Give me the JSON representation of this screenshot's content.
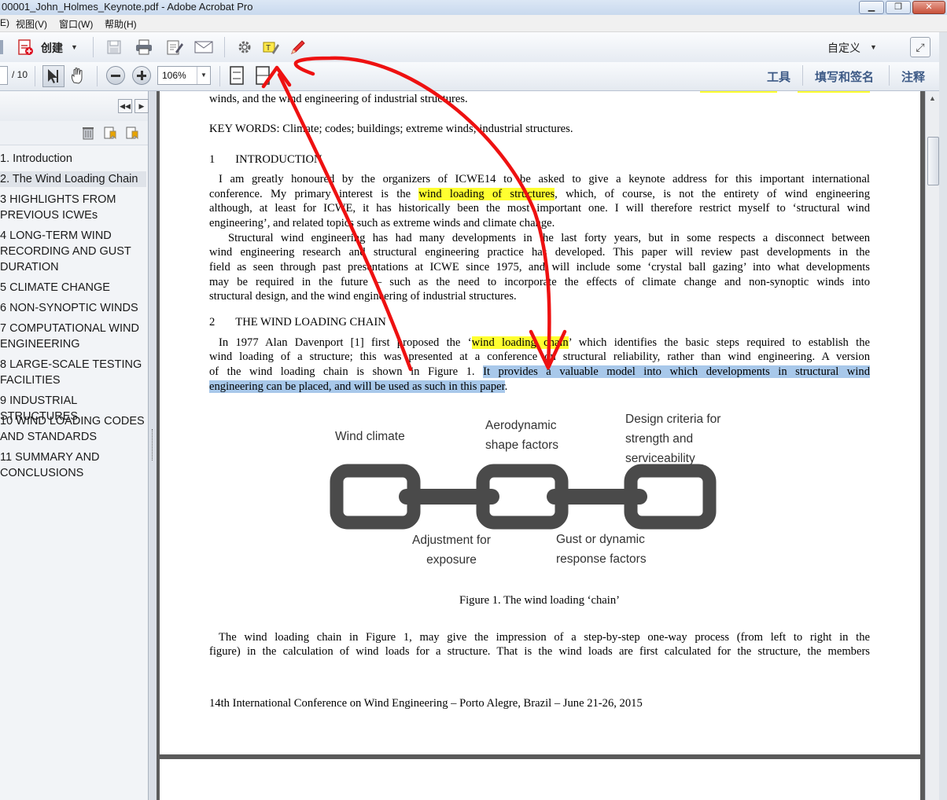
{
  "window": {
    "title": "00001_John_Holmes_Keynote.pdf - Adobe Acrobat Pro"
  },
  "menu": [
    "E)",
    "视图(V)",
    "窗口(W)",
    "帮助(H)"
  ],
  "toolbar": {
    "create_label": "创建",
    "customize_label": "自定义",
    "page_suffix": "/ 10",
    "zoom_value": "106%",
    "tools_label": "工具",
    "fill_sign_label": "填写和签名",
    "comment_label": "注释"
  },
  "bookmarks": [
    "1. Introduction",
    "2. The Wind Loading Chain",
    "3 HIGHLIGHTS FROM\nPREVIOUS ICWEs",
    "4 LONG-TERM WIND\nRECORDING AND GUST\nDURATION",
    "5 CLIMATE CHANGE",
    "6 NON-SYNOPTIC WINDS",
    "7 COMPUTATIONAL WIND\nENGINEERING",
    "8 LARGE-SCALE TESTING\nFACILITIES",
    "9 INDUSTRIAL STRUCTURES",
    "10 WIND LOADING CODES\nAND STANDARDS",
    "11 SUMMARY AND\nCONCLUSIONS"
  ],
  "document": {
    "line_top": "winds, and the wind engineering of industrial structures.",
    "keywords": "KEY WORDS: Climate; codes; buildings; extreme winds; industrial structures.",
    "h1_num": "1",
    "h1_title": "INTRODUCTION",
    "p1_l1": "I am greatly honoured by the organizers of ICWE14 to be asked to give a keynote address for this important international",
    "p1_l2a": "conference.    My primary interest is the ",
    "p1_l2_hl": "wind loading of structures",
    "p1_l2b": ", which, of course, is not the entirety of wind engineering",
    "p1_l3": "although, at least for ICWE, it has historically been the most important one.    I will therefore restrict myself to ‘structural wind",
    "p1_l4": "engineering’, and related topics such as extreme winds and climate change.",
    "p2_l1": "Structural wind engineering has had many developments in the last forty years, but in some respects a disconnect between",
    "p2_l2": "wind engineering research and structural engineering practice has developed.   This paper will review past developments in the",
    "p2_l3": "field as seen through past presentations at ICWE since 1975, and will include some ‘crystal ball gazing’ into what developments",
    "p2_l4": "may be required in the future – such as the need to incorporate the effects of climate change and non-synoptic winds into",
    "p2_l5": "structural design, and the wind engineering of industrial structures.",
    "h2_num": "2",
    "h2_title": "THE WIND LOADING CHAIN",
    "p3_l1a": "In 1977 Alan Davenport [1] first proposed the ‘",
    "p3_l1_hl": "wind loading chain",
    "p3_l1b": "’ which identifies the basic steps required to establish the",
    "p3_l2": "wind loading of a structure; this was presented at a conference on structural reliability, rather than wind engineering.   A version",
    "p3_l3a": "of the wind loading chain is shown in Figure 1.    ",
    "p3_l3_sel": "It provides a valuable model into which developments in structural wind",
    "p3_l4_sel": "engineering can be placed, and will be used as such in this paper",
    "p3_l4b": ".",
    "fig_wind_climate": "Wind climate",
    "fig_aero": "Aerodynamic\nshape factors",
    "fig_design": "Design criteria for\nstrength and\nserviceability",
    "fig_adjust": "Adjustment for\nexposure",
    "fig_gust": "Gust or dynamic\nresponse factors",
    "fig_caption": "Figure 1. The wind loading ‘chain’",
    "p4_l1": "The wind loading chain in Figure 1, may give the impression of a step-by-step one-way process (from left to right in the",
    "p4_l2": "figure) in the calculation of wind loads for a structure.   That is the wind loads are first calculated for the structure, the members",
    "footer": "14th International Conference on Wind Engineering – Porto Alegre, Brazil – June 21-26, 2015"
  },
  "colors": {
    "highlight": "#ffff30",
    "selection": "#a8c8ea",
    "annotation": "#ee1111",
    "chain": "#4a4a4a"
  }
}
